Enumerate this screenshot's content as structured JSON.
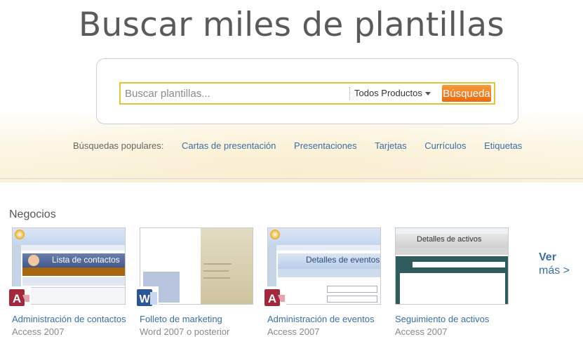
{
  "hero": {
    "title": "Buscar miles de plantillas"
  },
  "search": {
    "placeholder": "Buscar plantillas...",
    "product_filter": "Todos Productos",
    "button_label": "Búsqueda"
  },
  "popular": {
    "label": "Búsquedas populares:",
    "links": [
      "Cartas de presentación",
      "Presentaciones",
      "Tarjetas",
      "Currículos",
      "Etiquetas"
    ]
  },
  "section": {
    "title": "Negocios",
    "more_line1": "Ver",
    "more_line2": "más >",
    "templates": [
      {
        "title": "Administración de contactos",
        "subtitle": "Access 2007",
        "app": "access-icon",
        "thumb_text": "Lista de contactos"
      },
      {
        "title": "Folleto de marketing",
        "subtitle": "Word 2007 o posterior",
        "app": "word-icon"
      },
      {
        "title": "Administración de eventos",
        "subtitle": "Access 2007",
        "app": "access-icon",
        "thumb_text": "Detalles de eventos"
      },
      {
        "title": "Seguimiento de activos",
        "subtitle": "Access 2007",
        "app": "access-icon",
        "thumb_text": "Detalles de activos"
      }
    ]
  },
  "colors": {
    "link": "#3b6ea5",
    "search_button": "#ec6a10",
    "search_border": "#e0c636"
  }
}
